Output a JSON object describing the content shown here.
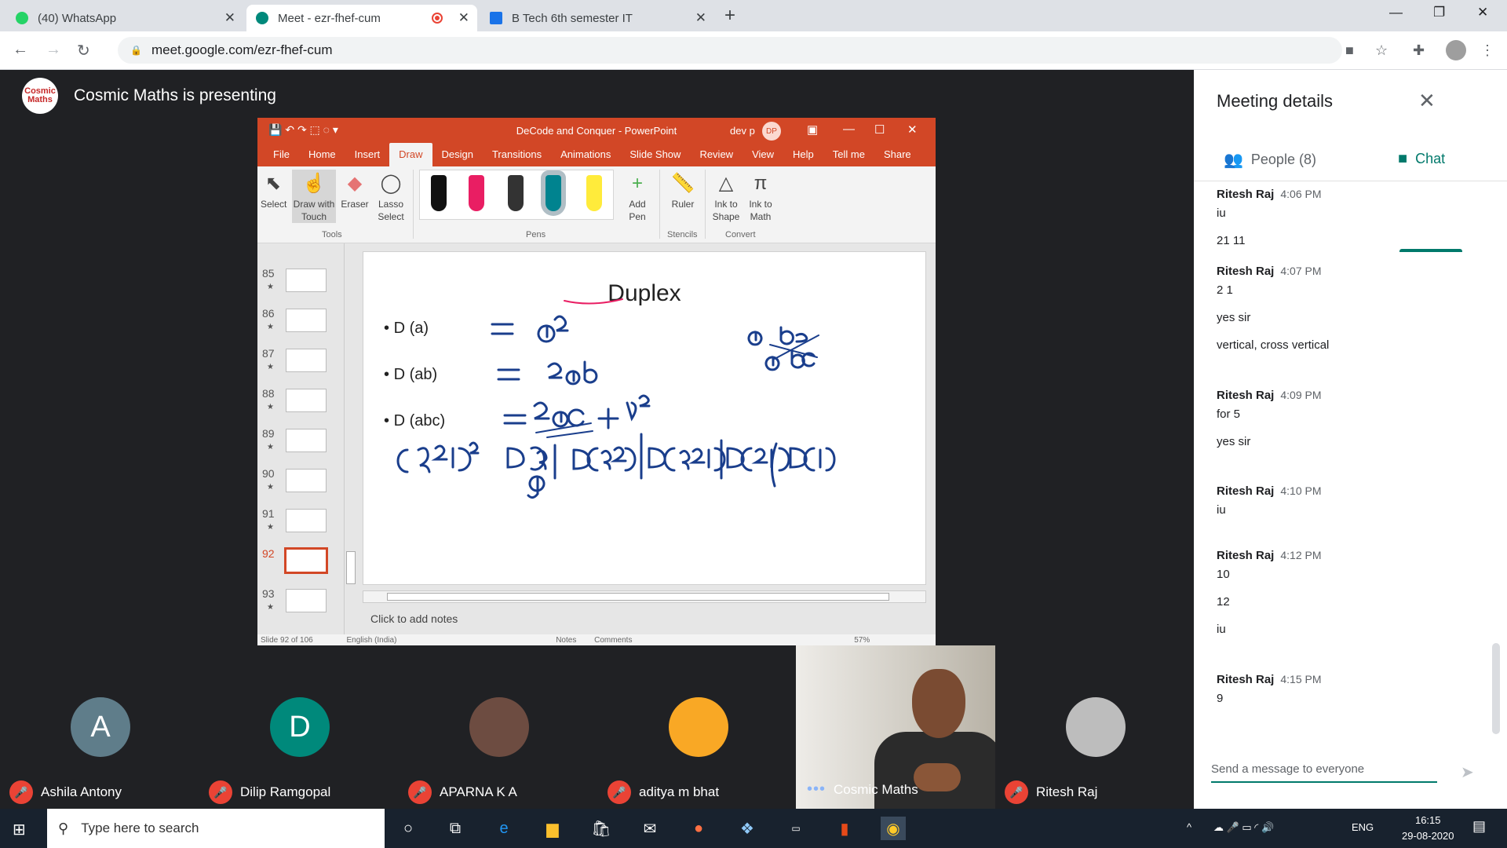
{
  "tabs": [
    {
      "title": "(40) WhatsApp"
    },
    {
      "title": "Meet - ezr-fhef-cum"
    },
    {
      "title": "B Tech 6th semester IT"
    }
  ],
  "address": {
    "url": "meet.google.com/ezr-fhef-cum"
  },
  "presenter": {
    "logo": "Cosmic Maths",
    "text": "Cosmic Maths is presenting"
  },
  "ppt": {
    "window_title": "DeCode and Conquer  -  PowerPoint",
    "user": "dev p",
    "user_initials": "DP",
    "ribbon_tabs": [
      "File",
      "Home",
      "Insert",
      "Draw",
      "Design",
      "Transitions",
      "Animations",
      "Slide Show",
      "Review",
      "View",
      "Help",
      "Tell me",
      "Share"
    ],
    "tools": [
      {
        "label": "Select"
      },
      {
        "label": "Draw with Touch"
      },
      {
        "label": "Eraser"
      },
      {
        "label": "Lasso Select"
      }
    ],
    "group_tools": "Tools",
    "group_pens": "Pens",
    "group_stencils": "Stencils",
    "group_convert": "Convert",
    "add_pen": "Add Pen",
    "ruler": "Ruler",
    "ink_to_shape": "Ink to Shape",
    "ink_to_math": "Ink to Math",
    "slides": [
      "85",
      "86",
      "87",
      "88",
      "89",
      "90",
      "91",
      "92",
      "93"
    ],
    "slide_title": "Duplex",
    "bullets": [
      "D (a)",
      "D (ab)",
      "D (abc)"
    ],
    "notes_placeholder": "Click to add notes",
    "status": {
      "slide": "Slide 92 of 106",
      "lang": "English (India)",
      "notes": "Notes",
      "comments": "Comments",
      "zoom": "57%"
    }
  },
  "participants": [
    {
      "name": "Ashila Antony",
      "initial": "A",
      "color": "#5f7d8a"
    },
    {
      "name": "Dilip Ramgopal",
      "initial": "D",
      "color": "#00897b"
    },
    {
      "name": "APARNA K A",
      "initial": ""
    },
    {
      "name": "aditya m bhat",
      "initial": ""
    },
    {
      "name": "Cosmic Maths",
      "initial": ""
    },
    {
      "name": "Ritesh Raj",
      "initial": ""
    }
  ],
  "panel": {
    "title": "Meeting details",
    "people_tab": "People (8)",
    "chat_tab": "Chat",
    "messages": [
      {
        "sender": "Ritesh Raj",
        "time": "4:06 PM",
        "lines": [
          "iu",
          "21 11"
        ]
      },
      {
        "sender": "Ritesh Raj",
        "time": "4:07 PM",
        "lines": [
          "2 1",
          "yes sir",
          "vertical, cross vertical"
        ]
      },
      {
        "sender": "Ritesh Raj",
        "time": "4:09 PM",
        "lines": [
          "for 5",
          "yes sir"
        ]
      },
      {
        "sender": "Ritesh Raj",
        "time": "4:10 PM",
        "lines": [
          "iu"
        ]
      },
      {
        "sender": "Ritesh Raj",
        "time": "4:12 PM",
        "lines": [
          "10",
          "12",
          "iu"
        ]
      },
      {
        "sender": "Ritesh Raj",
        "time": "4:15 PM",
        "lines": [
          "9"
        ]
      }
    ],
    "compose_placeholder": "Send a message to everyone"
  },
  "taskbar": {
    "search": "Type here to search",
    "lang": "ENG",
    "time": "16:15",
    "date": "29-08-2020"
  }
}
